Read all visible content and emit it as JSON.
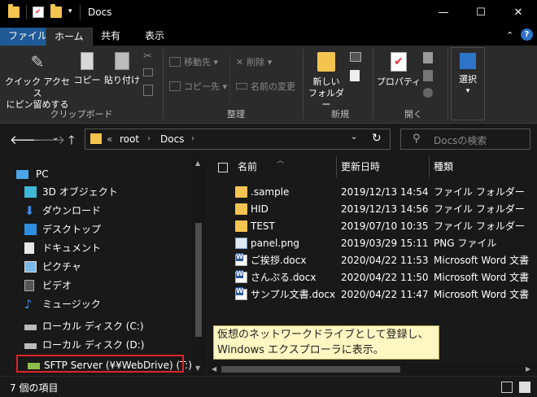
{
  "window": {
    "title": "Docs",
    "minimize": "—",
    "maximize": "☐",
    "close": "✕"
  },
  "tabs": [
    {
      "label": "ファイル"
    },
    {
      "label": "ホーム"
    },
    {
      "label": "共有"
    },
    {
      "label": "表示"
    }
  ],
  "ribbon": {
    "pin": [
      "クイック アクセス",
      "にピン留めする"
    ],
    "copy": "コピー",
    "paste": "貼り付け",
    "clipboard_label": "クリップボード",
    "move_to": "移動先",
    "copy_to": "コピー先",
    "delete": "削除",
    "rename": "名前の変更",
    "organize_label": "整理",
    "new_folder": [
      "新しい",
      "フォルダー"
    ],
    "new_label": "新規",
    "properties": "プロパティ",
    "open_label": "開く",
    "select": "選択"
  },
  "address": {
    "prefix": "«",
    "segments": [
      "root",
      "Docs"
    ],
    "search_placeholder": "Docsの検索"
  },
  "nav": {
    "items": [
      {
        "label": "PC"
      },
      {
        "label": "3D オブジェクト"
      },
      {
        "label": "ダウンロード"
      },
      {
        "label": "デスクトップ"
      },
      {
        "label": "ドキュメント"
      },
      {
        "label": "ピクチャ"
      },
      {
        "label": "ビデオ"
      },
      {
        "label": "ミュージック"
      },
      {
        "label": "ローカル ディスク (C:)"
      },
      {
        "label": "ローカル ディスク (D:)"
      },
      {
        "label": "SFTP Server (¥¥WebDrive) (T:)"
      }
    ]
  },
  "columns": {
    "name": "名前",
    "date": "更新日時",
    "type": "種類"
  },
  "files": [
    {
      "name": ".sample",
      "date": "2019/12/13 14:54",
      "type": "ファイル フォルダー",
      "icon": "folder-icon"
    },
    {
      "name": "HID",
      "date": "2019/12/13 14:56",
      "type": "ファイル フォルダー",
      "icon": "folder-icon"
    },
    {
      "name": "TEST",
      "date": "2019/07/10 10:35",
      "type": "ファイル フォルダー",
      "icon": "folder-icon"
    },
    {
      "name": "panel.png",
      "date": "2019/03/29 15:11",
      "type": "PNG ファイル",
      "icon": "image-icon"
    },
    {
      "name": "ご挨拶.docx",
      "date": "2020/04/22 11:53",
      "type": "Microsoft Word 文書",
      "icon": "word-icon"
    },
    {
      "name": "さんぷる.docx",
      "date": "2020/04/22 11:50",
      "type": "Microsoft Word 文書",
      "icon": "word-icon"
    },
    {
      "name": "サンプル文書.docx",
      "date": "2020/04/22 11:47",
      "type": "Microsoft Word 文書",
      "icon": "word-icon"
    }
  ],
  "callout": [
    "仮想のネットワークドライブとして登録し、",
    "Windows エクスプローラに表示。"
  ],
  "status": {
    "item_count": "7 個の項目"
  },
  "colors": {
    "accent": "#1f5a96",
    "highlight": "#e0242a",
    "folder": "#f3c44f",
    "callout_bg": "#fff7c2"
  }
}
